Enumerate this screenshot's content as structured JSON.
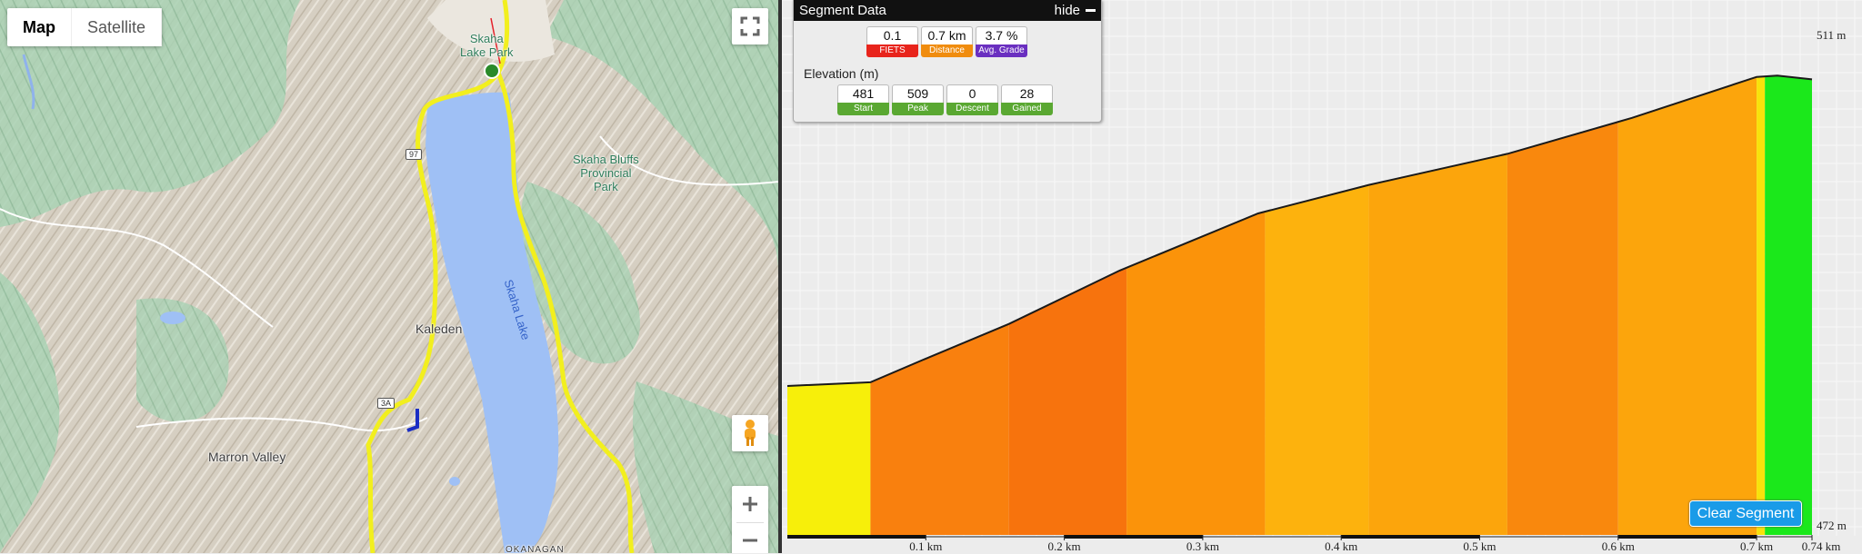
{
  "map": {
    "type_buttons": [
      "Map",
      "Satellite"
    ],
    "active_type": "Map",
    "labels": {
      "skaha_lake_park": "Skaha\nLake Park",
      "skaha_bluffs": "Skaha Bluffs\nProvincial\nPark",
      "skaha_lake": "Skaha Lake",
      "kaleden": "Kaleden",
      "marron_valley": "Marron Valley",
      "okanagan": "OKANAGAN",
      "hwy97": "97",
      "hwy3a": "3A"
    },
    "icons": [
      "fullscreen-icon",
      "pegman-icon",
      "zoom-in-icon",
      "zoom-out-icon"
    ]
  },
  "segment": {
    "title": "Segment Data",
    "hide_label": "hide",
    "stats": [
      {
        "value": "0.1",
        "label": "FIETS",
        "color": "#e8241c"
      },
      {
        "value": "0.7 km",
        "label": "Distance",
        "color": "#f08c0e"
      },
      {
        "value": "3.7 %",
        "label": "Avg. Grade",
        "color": "#6a2fc0"
      }
    ],
    "elevation_title": "Elevation (m)",
    "elevation": [
      {
        "value": "481",
        "label": "Start",
        "color": "#5aa832"
      },
      {
        "value": "509",
        "label": "Peak",
        "color": "#5aa832"
      },
      {
        "value": "0",
        "label": "Descent",
        "color": "#5aa832"
      },
      {
        "value": "28",
        "label": "Gained",
        "color": "#5aa832"
      }
    ]
  },
  "profile": {
    "clear_button": "Clear Segment",
    "y_top_label": "511 m",
    "y_bottom_label": "472 m"
  },
  "chart_data": {
    "type": "area",
    "x_unit": "km",
    "y_unit": "m",
    "ylim": [
      472,
      511
    ],
    "xlim": [
      0,
      0.74
    ],
    "tick_labels": [
      "0.1 km",
      "0.2 km",
      "0.3 km",
      "0.4 km",
      "0.5 km",
      "0.6 km",
      "0.7 km",
      "0.74 km"
    ],
    "ticks": [
      0.1,
      0.2,
      0.3,
      0.4,
      0.5,
      0.6,
      0.7,
      0.74
    ],
    "profile": [
      {
        "x": 0.0,
        "y": 484.0
      },
      {
        "x": 0.06,
        "y": 484.3
      },
      {
        "x": 0.1,
        "y": 486.2
      },
      {
        "x": 0.16,
        "y": 489.0
      },
      {
        "x": 0.24,
        "y": 493.3
      },
      {
        "x": 0.34,
        "y": 497.9
      },
      {
        "x": 0.42,
        "y": 500.2
      },
      {
        "x": 0.52,
        "y": 502.7
      },
      {
        "x": 0.61,
        "y": 505.6
      },
      {
        "x": 0.7,
        "y": 508.9
      },
      {
        "x": 0.715,
        "y": 509.0
      },
      {
        "x": 0.74,
        "y": 508.7
      }
    ],
    "bands": [
      {
        "x0": 0.0,
        "x1": 0.06,
        "color": "#f7ef0a"
      },
      {
        "x0": 0.06,
        "x1": 0.16,
        "color": "#f9800e"
      },
      {
        "x0": 0.16,
        "x1": 0.245,
        "color": "#f7730d"
      },
      {
        "x0": 0.245,
        "x1": 0.345,
        "color": "#fb930a"
      },
      {
        "x0": 0.345,
        "x1": 0.42,
        "color": "#fdb20d"
      },
      {
        "x0": 0.42,
        "x1": 0.52,
        "color": "#fca50c"
      },
      {
        "x0": 0.52,
        "x1": 0.6,
        "color": "#f9880d"
      },
      {
        "x0": 0.6,
        "x1": 0.7,
        "color": "#fca50c"
      },
      {
        "x0": 0.7,
        "x1": 0.706,
        "color": "#f8e20b"
      },
      {
        "x0": 0.706,
        "x1": 0.74,
        "color": "#1be81b"
      }
    ]
  }
}
